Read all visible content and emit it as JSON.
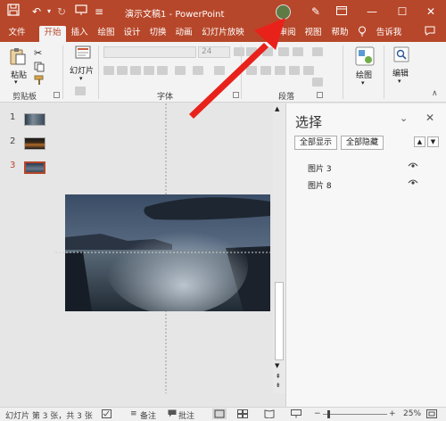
{
  "titlebar": {
    "title": "演示文稿1 - PowerPoint",
    "save_icon": "save-icon",
    "undo_icon": "undo-icon",
    "redo_icon": "redo-icon",
    "present_icon": "present-icon",
    "more_icon": "customize-toolbar-icon",
    "pen_icon": "pen-icon",
    "ribbon_display_icon": "ribbon-display-icon",
    "minimize": "—",
    "maximize": "☐",
    "close": "✕"
  },
  "tabs": [
    {
      "label": "文件",
      "active": false
    },
    {
      "label": "开始",
      "active": true
    },
    {
      "label": "插入",
      "active": false
    },
    {
      "label": "绘图",
      "active": false
    },
    {
      "label": "设计",
      "active": false
    },
    {
      "label": "切换",
      "active": false
    },
    {
      "label": "动画",
      "active": false
    },
    {
      "label": "幻灯片放映",
      "active": false
    },
    {
      "label": "审阅",
      "active": false
    },
    {
      "label": "视图",
      "active": false
    },
    {
      "label": "帮助",
      "active": false
    }
  ],
  "tell_me": "告诉我",
  "ribbon": {
    "paste_label": "粘贴",
    "clipboard_label": "剪贴板",
    "new_slide_label": "幻灯片",
    "font_label": "字体",
    "font_size": "24",
    "paragraph_label": "段落",
    "draw_label": "绘图",
    "edit_label": "编辑"
  },
  "slides": [
    {
      "number": "1",
      "selected": false
    },
    {
      "number": "2",
      "selected": false
    },
    {
      "number": "3",
      "selected": true
    }
  ],
  "selection_pane": {
    "title": "选择",
    "show_all": "全部显示",
    "hide_all": "全部隐藏",
    "items": [
      {
        "name": "图片 3"
      },
      {
        "name": "图片 8"
      }
    ]
  },
  "statusbar": {
    "slide_info": "幻灯片 第 3 张，共 3 张",
    "notes": "备注",
    "comments": "批注",
    "zoom": "25%"
  },
  "colors": {
    "accent": "#b7472a",
    "annotation_arrow": "#e8221b"
  }
}
